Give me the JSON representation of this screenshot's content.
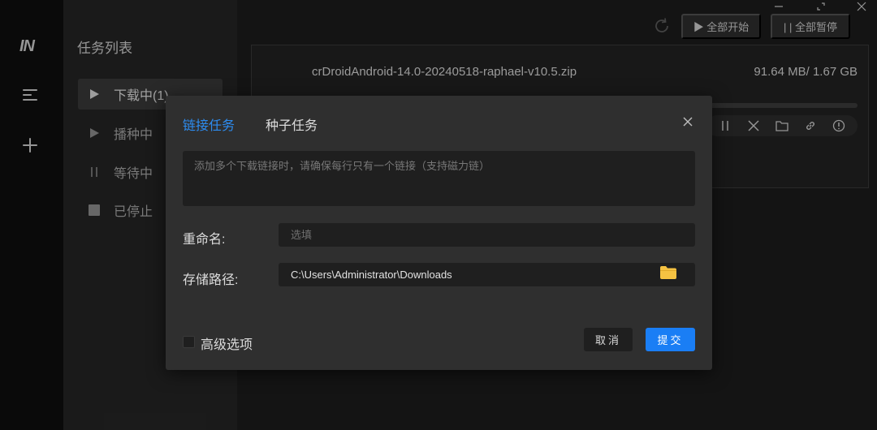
{
  "rail": {
    "logo_text": "IN",
    "icons": [
      "menu-icon",
      "plus-icon"
    ]
  },
  "panel": {
    "title": "任务列表",
    "nav": [
      {
        "label": "下载中(1)",
        "icon": "play-icon",
        "active": true
      },
      {
        "label": "播种中",
        "icon": "play-icon",
        "active": false
      },
      {
        "label": "等待中",
        "icon": "pause-icon",
        "active": false
      },
      {
        "label": "已停止",
        "icon": "stop-icon",
        "active": false
      }
    ]
  },
  "toolbar": {
    "start_all": "▶ 全部开始",
    "pause_all": "| | 全部暂停"
  },
  "task": {
    "name": "crDroidAndroid-14.0-20240518-raphael-v10.5.zip",
    "size": "91.64 MB/ 1.67 GB",
    "progress_percent": 5.4
  },
  "dialog": {
    "tabs": [
      {
        "label": "链接任务",
        "active": true
      },
      {
        "label": "种子任务",
        "active": false
      }
    ],
    "links_placeholder": "添加多个下载链接时，请确保每行只有一个链接（支持磁力链）",
    "rename_label": "重命名:",
    "rename_placeholder": "选填",
    "path_label": "存储路径:",
    "path_value": "C:\\Users\\Administrator\\Downloads",
    "advanced_label": "高级选项",
    "cancel_label": "取消",
    "submit_label": "提交"
  },
  "colors": {
    "accent": "#2d8cf0",
    "submit": "#1a7ef5",
    "folder": "#f5c242"
  }
}
